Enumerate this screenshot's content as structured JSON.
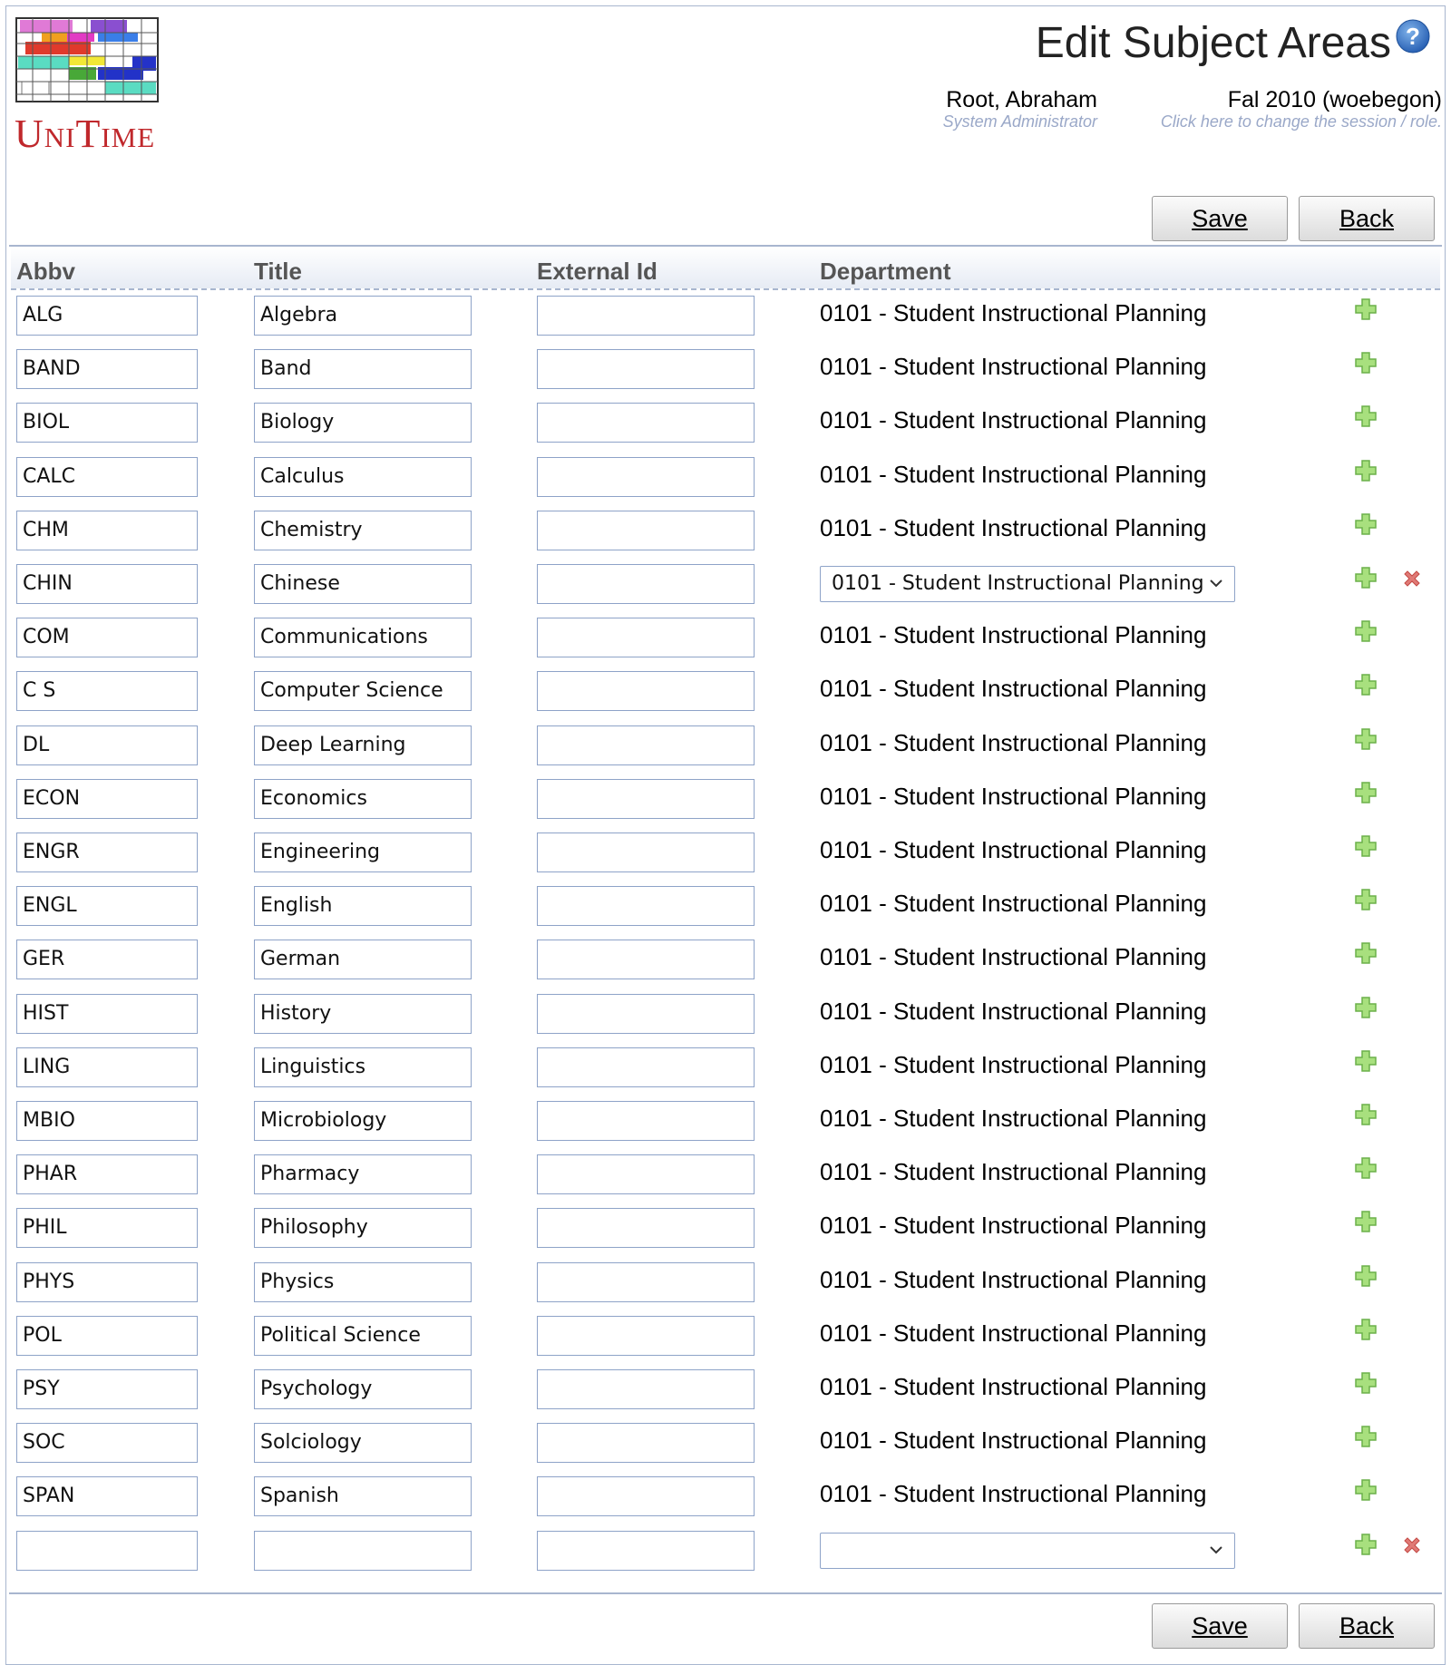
{
  "app": {
    "logo_text": "UniTime",
    "page_title": "Edit Subject Areas"
  },
  "user": {
    "name": "Root, Abraham",
    "role": "System Administrator"
  },
  "session": {
    "name": "Fal 2010 (woebegon)",
    "hint": "Click here to change the session / role."
  },
  "buttons": {
    "save_label": "Save",
    "back_label": "Back"
  },
  "columns": [
    "Abbv",
    "Title",
    "External Id",
    "Department"
  ],
  "rows": [
    {
      "abbv": "ALG",
      "title": "Algebra",
      "external_id": "",
      "department": "0101 - Student Instructional Planning",
      "editing": false
    },
    {
      "abbv": "BAND",
      "title": "Band",
      "external_id": "",
      "department": "0101 - Student Instructional Planning",
      "editing": false
    },
    {
      "abbv": "BIOL",
      "title": "Biology",
      "external_id": "",
      "department": "0101 - Student Instructional Planning",
      "editing": false
    },
    {
      "abbv": "CALC",
      "title": "Calculus",
      "external_id": "",
      "department": "0101 - Student Instructional Planning",
      "editing": false
    },
    {
      "abbv": "CHM",
      "title": "Chemistry",
      "external_id": "",
      "department": "0101 - Student Instructional Planning",
      "editing": false
    },
    {
      "abbv": "CHIN",
      "title": "Chinese",
      "external_id": "",
      "department": "0101 - Student Instructional Planning",
      "editing": true
    },
    {
      "abbv": "COM",
      "title": "Communications",
      "external_id": "",
      "department": "0101 - Student Instructional Planning",
      "editing": false
    },
    {
      "abbv": "C S",
      "title": "Computer Science",
      "external_id": "",
      "department": "0101 - Student Instructional Planning",
      "editing": false
    },
    {
      "abbv": "DL",
      "title": "Deep Learning",
      "external_id": "",
      "department": "0101 - Student Instructional Planning",
      "editing": false
    },
    {
      "abbv": "ECON",
      "title": "Economics",
      "external_id": "",
      "department": "0101 - Student Instructional Planning",
      "editing": false
    },
    {
      "abbv": "ENGR",
      "title": "Engineering",
      "external_id": "",
      "department": "0101 - Student Instructional Planning",
      "editing": false
    },
    {
      "abbv": "ENGL",
      "title": "English",
      "external_id": "",
      "department": "0101 - Student Instructional Planning",
      "editing": false
    },
    {
      "abbv": "GER",
      "title": "German",
      "external_id": "",
      "department": "0101 - Student Instructional Planning",
      "editing": false
    },
    {
      "abbv": "HIST",
      "title": "History",
      "external_id": "",
      "department": "0101 - Student Instructional Planning",
      "editing": false
    },
    {
      "abbv": "LING",
      "title": "Linguistics",
      "external_id": "",
      "department": "0101 - Student Instructional Planning",
      "editing": false
    },
    {
      "abbv": "MBIO",
      "title": "Microbiology",
      "external_id": "",
      "department": "0101 - Student Instructional Planning",
      "editing": false
    },
    {
      "abbv": "PHAR",
      "title": "Pharmacy",
      "external_id": "",
      "department": "0101 - Student Instructional Planning",
      "editing": false
    },
    {
      "abbv": "PHIL",
      "title": "Philosophy",
      "external_id": "",
      "department": "0101 - Student Instructional Planning",
      "editing": false
    },
    {
      "abbv": "PHYS",
      "title": "Physics",
      "external_id": "",
      "department": "0101 - Student Instructional Planning",
      "editing": false
    },
    {
      "abbv": "POL",
      "title": "Political Science",
      "external_id": "",
      "department": "0101 - Student Instructional Planning",
      "editing": false
    },
    {
      "abbv": "PSY",
      "title": "Psychology",
      "external_id": "",
      "department": "0101 - Student Instructional Planning",
      "editing": false
    },
    {
      "abbv": "SOC",
      "title": "Solciology",
      "external_id": "",
      "department": "0101 - Student Instructional Planning",
      "editing": false
    },
    {
      "abbv": "SPAN",
      "title": "Spanish",
      "external_id": "",
      "department": "0101 - Student Instructional Planning",
      "editing": false
    },
    {
      "abbv": "",
      "title": "",
      "external_id": "",
      "department": "",
      "editing": true
    }
  ],
  "colors": {
    "border": "#a8b6cf",
    "input_border": "#8ea3c8",
    "add_icon": "#8fd16a",
    "delete_icon": "#d9534f",
    "logo_text": "#c0282c"
  },
  "icons": {
    "add": "plus-icon",
    "delete": "delete-icon",
    "help": "help-icon",
    "dropdown": "chevron-down-icon"
  }
}
